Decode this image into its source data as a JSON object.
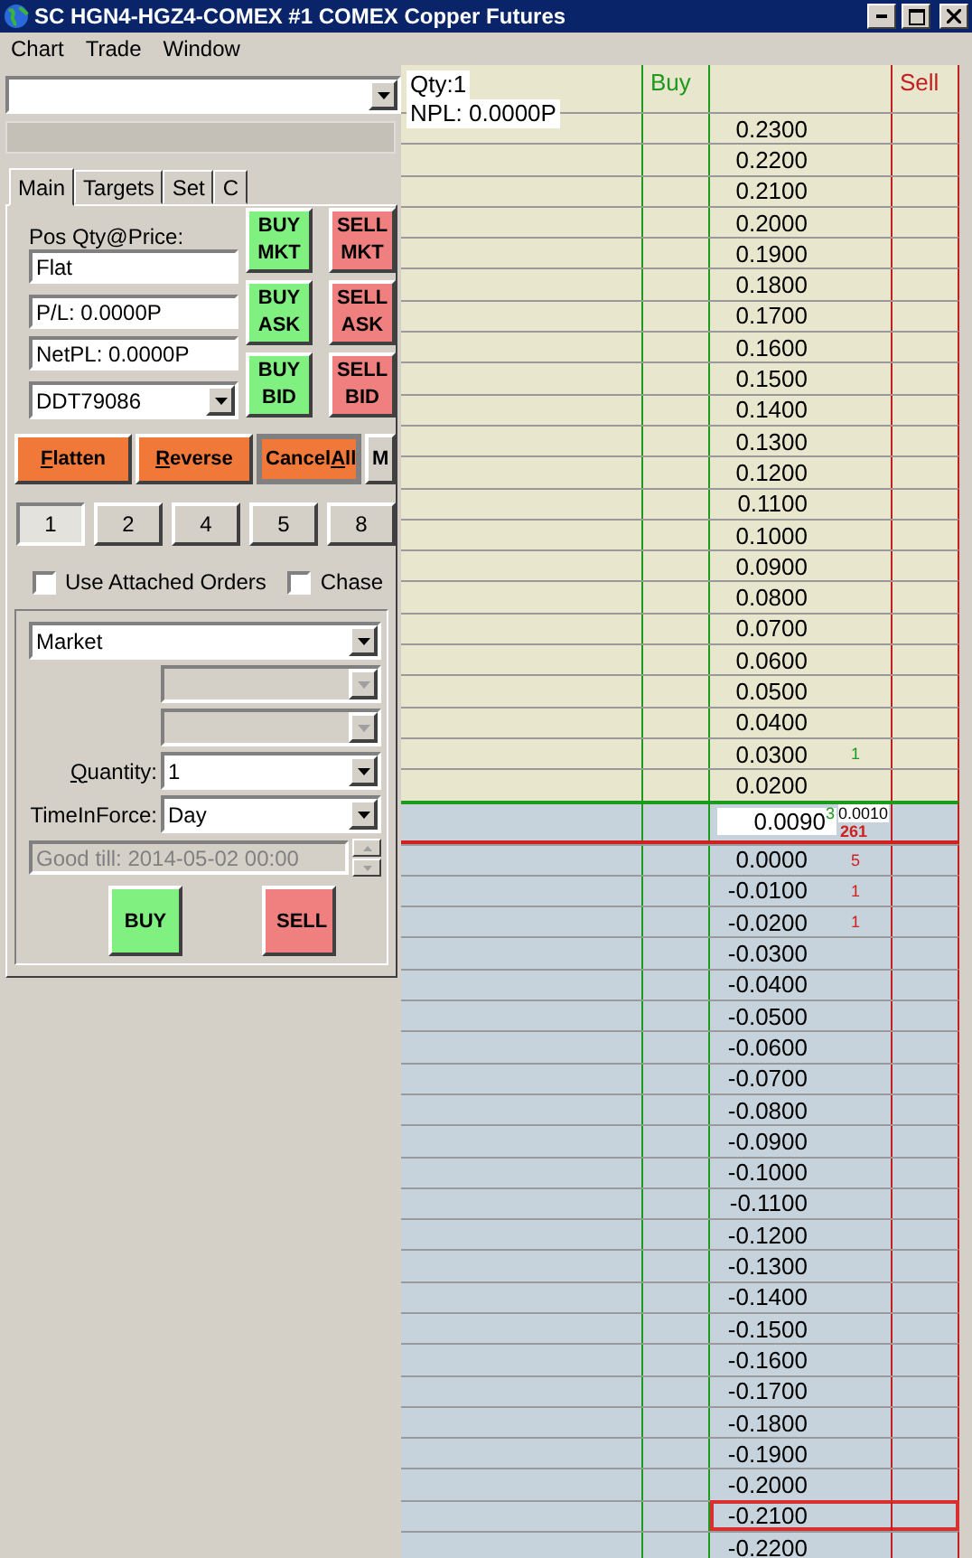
{
  "window": {
    "title": "SC HGN4-HGZ4-COMEX  #1  COMEX Copper Futures"
  },
  "menu": [
    "Chart",
    "Trade",
    "Window"
  ],
  "tabs": [
    {
      "label": "Main",
      "selected": true
    },
    {
      "label": "Targets",
      "selected": false
    },
    {
      "label": "Set",
      "selected": false
    },
    {
      "label": "C",
      "selected": false
    }
  ],
  "position": {
    "label": "Pos Qty@Price:",
    "value": "Flat"
  },
  "pl": "P/L: 0.0000P",
  "net_pl": "NetPL: 0.0000P",
  "account": "DDT79086",
  "trade_buttons": [
    {
      "kind": "buy",
      "lines": [
        "BUY",
        "MKT"
      ]
    },
    {
      "kind": "sell",
      "lines": [
        "SELL",
        "MKT"
      ]
    },
    {
      "kind": "buy",
      "lines": [
        "BUY",
        "ASK"
      ]
    },
    {
      "kind": "sell",
      "lines": [
        "SELL",
        "ASK"
      ]
    },
    {
      "kind": "buy",
      "lines": [
        "BUY",
        "BID"
      ]
    },
    {
      "kind": "sell",
      "lines": [
        "SELL",
        "BID"
      ]
    }
  ],
  "action_buttons": [
    {
      "kind": "orange",
      "label": "Flatten"
    },
    {
      "kind": "orange",
      "label": "Reverse"
    },
    {
      "kind": "framed",
      "label": "CancelAll"
    },
    {
      "kind": "grey",
      "label": "M"
    }
  ],
  "quantity_presets": [
    {
      "label": "1",
      "selected": true
    },
    {
      "label": "2",
      "selected": false
    },
    {
      "label": "4",
      "selected": false
    },
    {
      "label": "5",
      "selected": false
    },
    {
      "label": "8",
      "selected": false
    }
  ],
  "options": [
    {
      "label": "Use Attached Orders",
      "checked": false
    },
    {
      "label": "Chase",
      "checked": false
    }
  ],
  "order_type": "Market",
  "quantity": {
    "label": "Quantity:",
    "value": "1"
  },
  "time_in_force": {
    "label": "TimeInForce:",
    "value": "Day"
  },
  "good_till": {
    "value": "Good till: 2014-05-02 00:00",
    "disabled": true
  },
  "order_buttons": [
    {
      "kind": "buy",
      "label": "BUY"
    },
    {
      "kind": "sell",
      "label": "SELL"
    }
  ],
  "ladder": {
    "qty": "Qty:1",
    "npl": "NPL: 0.0000P",
    "buy_header": "Buy",
    "sell_header": "Sell",
    "rows": [
      {
        "kind": "above",
        "price": "0.2300",
        "selected": false
      },
      {
        "kind": "above",
        "price": "0.2200",
        "selected": false
      },
      {
        "kind": "above",
        "price": "0.2100",
        "selected": false
      },
      {
        "kind": "above",
        "price": "0.2000",
        "selected": false
      },
      {
        "kind": "above",
        "price": "0.1900",
        "selected": false
      },
      {
        "kind": "above",
        "price": "0.1800",
        "selected": false
      },
      {
        "kind": "above",
        "price": "0.1700",
        "selected": false
      },
      {
        "kind": "above",
        "price": "0.1600",
        "selected": false
      },
      {
        "kind": "above",
        "price": "0.1500",
        "selected": false
      },
      {
        "kind": "above",
        "price": "0.1400",
        "selected": false
      },
      {
        "kind": "above",
        "price": "0.1300",
        "selected": false
      },
      {
        "kind": "above",
        "price": "0.1200",
        "selected": false
      },
      {
        "kind": "above",
        "price": "0.1100",
        "selected": false
      },
      {
        "kind": "above",
        "price": "0.1000",
        "selected": false
      },
      {
        "kind": "above",
        "price": "0.0900",
        "selected": false
      },
      {
        "kind": "above",
        "price": "0.0800",
        "selected": false
      },
      {
        "kind": "above",
        "price": "0.0700",
        "selected": false
      },
      {
        "kind": "above",
        "price": "0.0600",
        "selected": false
      },
      {
        "kind": "above",
        "price": "0.0500",
        "selected": false
      },
      {
        "kind": "above",
        "price": "0.0400",
        "selected": false
      },
      {
        "kind": "above",
        "price": "0.0300",
        "selected": false,
        "buy_mark": "1"
      },
      {
        "kind": "above",
        "price": "0.0200",
        "selected": false
      },
      {
        "kind": "last",
        "price": "0.0090",
        "selected": false,
        "buy_mark": "3",
        "note": "0.0010",
        "sell_mark": "261"
      },
      {
        "kind": "below",
        "price": "0.0000",
        "selected": false,
        "sell_mark": "5"
      },
      {
        "kind": "below",
        "price": "-0.0100",
        "selected": false,
        "sell_mark": "1"
      },
      {
        "kind": "below",
        "price": "-0.0200",
        "selected": false,
        "sell_mark": "1"
      },
      {
        "kind": "below",
        "price": "-0.0300",
        "selected": false
      },
      {
        "kind": "below",
        "price": "-0.0400",
        "selected": false
      },
      {
        "kind": "below",
        "price": "-0.0500",
        "selected": false
      },
      {
        "kind": "below",
        "price": "-0.0600",
        "selected": false
      },
      {
        "kind": "below",
        "price": "-0.0700",
        "selected": false
      },
      {
        "kind": "below",
        "price": "-0.0800",
        "selected": false
      },
      {
        "kind": "below",
        "price": "-0.0900",
        "selected": false
      },
      {
        "kind": "below",
        "price": "-0.1000",
        "selected": false
      },
      {
        "kind": "below",
        "price": "-0.1100",
        "selected": false
      },
      {
        "kind": "below",
        "price": "-0.1200",
        "selected": false
      },
      {
        "kind": "below",
        "price": "-0.1300",
        "selected": false
      },
      {
        "kind": "below",
        "price": "-0.1400",
        "selected": false
      },
      {
        "kind": "below",
        "price": "-0.1500",
        "selected": false
      },
      {
        "kind": "below",
        "price": "-0.1600",
        "selected": false
      },
      {
        "kind": "below",
        "price": "-0.1700",
        "selected": false
      },
      {
        "kind": "below",
        "price": "-0.1800",
        "selected": false
      },
      {
        "kind": "below",
        "price": "-0.1900",
        "selected": false
      },
      {
        "kind": "below",
        "price": "-0.2000",
        "selected": false
      },
      {
        "kind": "below",
        "price": "-0.2100",
        "selected": true
      },
      {
        "kind": "below",
        "price": "-0.2200",
        "selected": false
      }
    ]
  }
}
